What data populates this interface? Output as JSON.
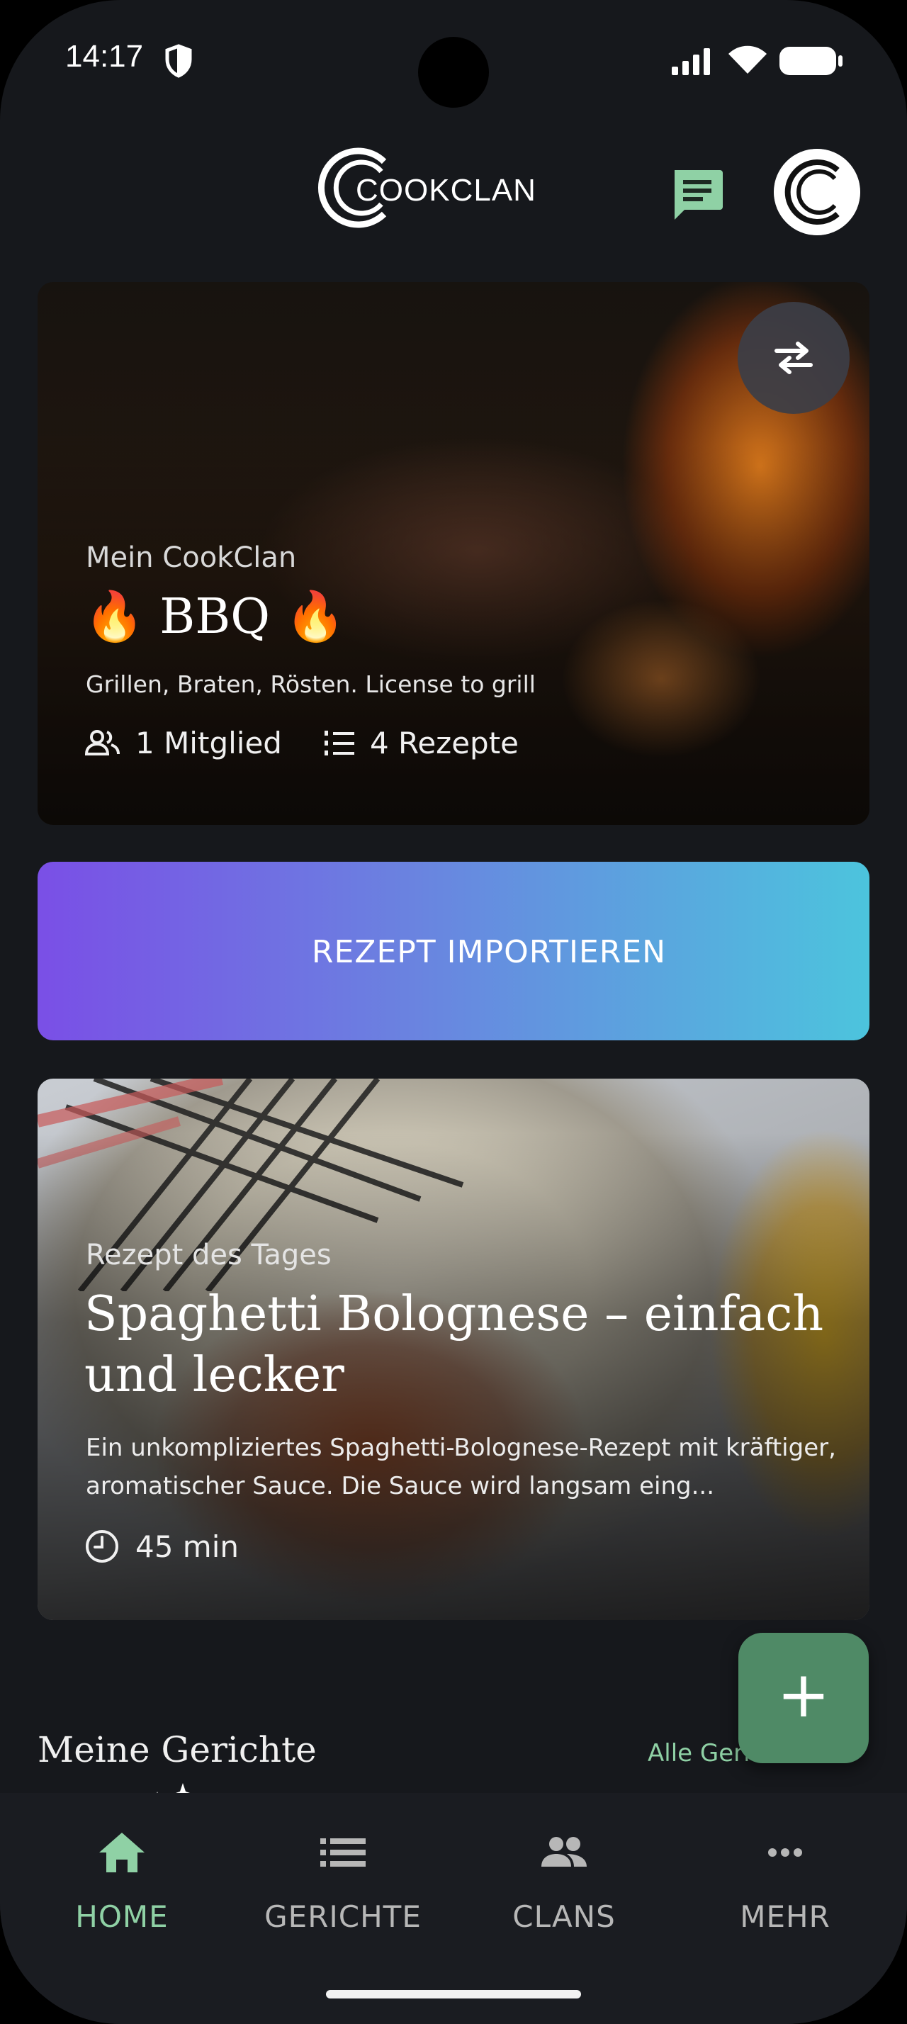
{
  "status_bar": {
    "time": "14:17"
  },
  "header": {
    "brand": "COOKCLAN"
  },
  "clan_card": {
    "overline": "Mein CookClan",
    "name": "🔥 BBQ 🔥",
    "description": "Grillen, Braten, Rösten. License to grill",
    "members": "1 Mitglied",
    "recipes": "4 Rezepte"
  },
  "import_button": {
    "label": "REZEPT IMPORTIEREN"
  },
  "recipe_of_day": {
    "overline": "Rezept des Tages",
    "title": "Spaghetti Bolognese – einfach und lecker",
    "description": "Ein unkompliziertes Spaghetti-Bolognese-Rezept mit kräftiger, aromatischer Sauce. Die Sauce wird langsam eing...",
    "time": "45 min"
  },
  "section": {
    "title": "Meine Gerichte",
    "link": "Alle Geric"
  },
  "fab": {
    "label": "+"
  },
  "bottom_nav": {
    "items": [
      {
        "label": "HOME",
        "icon": "home-icon",
        "active": true
      },
      {
        "label": "GERICHTE",
        "icon": "list-icon",
        "active": false
      },
      {
        "label": "CLANS",
        "icon": "people-icon",
        "active": false
      },
      {
        "label": "MEHR",
        "icon": "more-horizontal-icon",
        "active": false
      }
    ]
  },
  "colors": {
    "background": "#16181c",
    "accent_green": "#8fd1a5",
    "fab_green": "#4f8a66",
    "import_gradient_start": "#7a4fe6",
    "import_gradient_end": "#4cc4dd"
  }
}
